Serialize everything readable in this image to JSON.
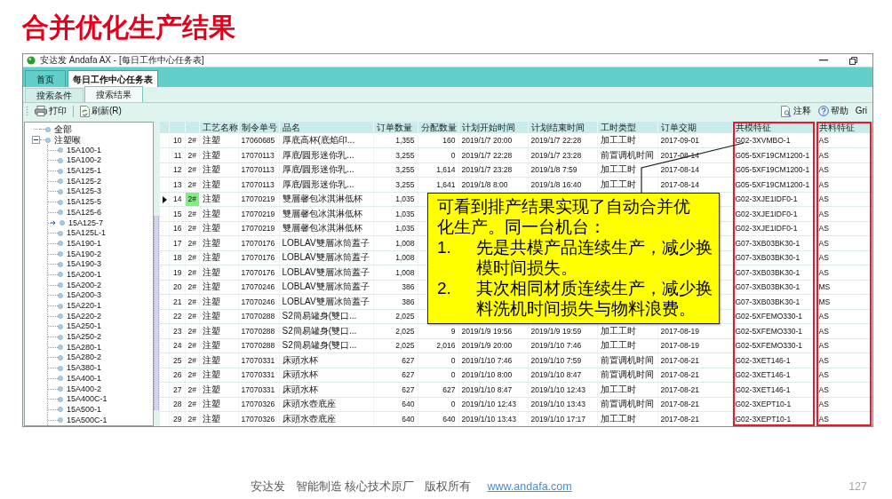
{
  "slide": {
    "title": "合并优化生产结果"
  },
  "window": {
    "title": "安达发 Andafa AX - [每日工作中心任务表]"
  },
  "tabs": [
    {
      "label": "首页",
      "selected": false
    },
    {
      "label": "每日工作中心任务表",
      "selected": true
    }
  ],
  "subtabs": [
    {
      "label": "搜索条件",
      "selected": false
    },
    {
      "label": "搜索结果",
      "selected": true
    }
  ],
  "toolbar": {
    "left": [
      {
        "label": "打印"
      },
      {
        "label": "刷新(R)"
      }
    ],
    "right": [
      {
        "label": "注释"
      },
      {
        "label": "帮助"
      },
      {
        "label": "Gri"
      }
    ]
  },
  "tree": [
    {
      "label": "全部",
      "selected": false
    },
    {
      "label": "注塑喉",
      "selected": false,
      "expanded": true,
      "children": [
        {
          "label": "15A100-1",
          "selected": false
        },
        {
          "label": "15A100-2",
          "selected": false
        },
        {
          "label": "15A125-1",
          "selected": false
        },
        {
          "label": "15A125-2",
          "selected": false
        },
        {
          "label": "15A125-3",
          "selected": false
        },
        {
          "label": "15A125-5",
          "selected": false
        },
        {
          "label": "15A125-6",
          "selected": false
        },
        {
          "label": "15A125-7",
          "selected": true
        },
        {
          "label": "15A125L-1",
          "selected": false
        },
        {
          "label": "15A190-1",
          "selected": false
        },
        {
          "label": "15A190-2",
          "selected": false
        },
        {
          "label": "15A190-3",
          "selected": false
        },
        {
          "label": "15A200-1",
          "selected": false
        },
        {
          "label": "15A200-2",
          "selected": false
        },
        {
          "label": "15A200-3",
          "selected": false
        },
        {
          "label": "15A220-1",
          "selected": false
        },
        {
          "label": "15A220-2",
          "selected": false
        },
        {
          "label": "15A250-1",
          "selected": false
        },
        {
          "label": "15A250-2",
          "selected": false
        },
        {
          "label": "15A280-1",
          "selected": false
        },
        {
          "label": "15A280-2",
          "selected": false
        },
        {
          "label": "15A380-1",
          "selected": false
        },
        {
          "label": "15A400-1",
          "selected": false
        },
        {
          "label": "15A400-2",
          "selected": false
        },
        {
          "label": "15A400C-1",
          "selected": false
        },
        {
          "label": "15A500-1",
          "selected": false
        },
        {
          "label": "15A500C-1",
          "selected": false
        }
      ]
    }
  ],
  "table": {
    "columns": [
      {
        "label": "工艺名称",
        "highlighted": false
      },
      {
        "label": "制令单号",
        "highlighted": false
      },
      {
        "label": "品名",
        "highlighted": false
      },
      {
        "label": "订单数量",
        "highlighted": false
      },
      {
        "label": "分配数量",
        "highlighted": false
      },
      {
        "label": "计划开始时间",
        "highlighted": false
      },
      {
        "label": "计划结束时间",
        "highlighted": false
      },
      {
        "label": "工时类型",
        "highlighted": false
      },
      {
        "label": "订单交期",
        "highlighted": false
      },
      {
        "label": "共模特征",
        "highlighted": true
      },
      {
        "label": "共料特征",
        "highlighted": true
      }
    ],
    "rows": [
      {
        "column_1": "10",
        "column_2": "2#",
        "selected": false,
        "cells": [
          "注塑",
          "17060685",
          "厚底高杯(底焰印...",
          "1,355",
          "160",
          "2019/1/7 20:00",
          "2019/1/7 22:28",
          "加工工时",
          "2017-09-01",
          "G02-3XVMBO-1",
          "AS"
        ]
      },
      {
        "column_1": "11",
        "column_2": "2#",
        "selected": false,
        "cells": [
          "注塑",
          "17070113",
          "厚底/圓形迷你乳...",
          "3,255",
          "0",
          "2019/1/7 22:28",
          "2019/1/7 23:28",
          "前置调机时间",
          "2017-08-14",
          "G05-5XF19CM1200-1",
          "AS"
        ]
      },
      {
        "column_1": "12",
        "column_2": "2#",
        "selected": false,
        "cells": [
          "注塑",
          "17070113",
          "厚底/圓形迷你乳...",
          "3,255",
          "1,614",
          "2019/1/7 23:28",
          "2019/1/8 7:59",
          "加工工时",
          "2017-08-14",
          "G05-5XF19CM1200-1",
          "AS"
        ]
      },
      {
        "column_1": "13",
        "column_2": "2#",
        "selected": false,
        "cells": [
          "注塑",
          "17070113",
          "厚底/圓形迷你乳...",
          "3,255",
          "1,641",
          "2019/1/8 8:00",
          "2019/1/8 16:40",
          "加工工时",
          "2017-08-14",
          "G05-5XF19CM1200-1",
          "AS"
        ]
      },
      {
        "column_1": "14",
        "column_2": "2#",
        "selected": true,
        "cells": [
          "注塑",
          "17070219",
          "雙層馨包冰淇淋低杯",
          "1,035",
          null,
          null,
          null,
          null,
          null,
          "G02-3XJE1IDF0-1",
          "AS"
        ]
      },
      {
        "column_1": "15",
        "column_2": "2#",
        "selected": false,
        "cells": [
          "注塑",
          "17070219",
          "雙層馨包冰淇淋低杯",
          "1,035",
          null,
          null,
          null,
          null,
          null,
          "G02-3XJE1IDF0-1",
          "AS"
        ]
      },
      {
        "column_1": "16",
        "column_2": "2#",
        "selected": false,
        "cells": [
          "注塑",
          "17070219",
          "雙層馨包冰淇淋低杯",
          "1,035",
          null,
          null,
          null,
          null,
          null,
          "G02-3XJE1IDF0-1",
          "AS"
        ]
      },
      {
        "column_1": "17",
        "column_2": "2#",
        "selected": false,
        "cells": [
          "注塑",
          "17070176",
          "LOBLAV雙層冰筒蓋子",
          "1,008",
          null,
          null,
          null,
          null,
          null,
          "G07-3XB03BK30-1",
          "AS"
        ]
      },
      {
        "column_1": "18",
        "column_2": "2#",
        "selected": false,
        "cells": [
          "注塑",
          "17070176",
          "LOBLAV雙層冰筒蓋子",
          "1,008",
          null,
          null,
          null,
          null,
          null,
          "G07-3XB03BK30-1",
          "AS"
        ]
      },
      {
        "column_1": "19",
        "column_2": "2#",
        "selected": false,
        "cells": [
          "注塑",
          "17070176",
          "LOBLAV雙層冰筒蓋子",
          "1,008",
          null,
          null,
          null,
          null,
          null,
          "G07-3XB03BK30-1",
          "AS"
        ]
      },
      {
        "column_1": "20",
        "column_2": "2#",
        "selected": false,
        "cells": [
          "注塑",
          "17070246",
          "LOBLAV雙層冰筒蓋子",
          "386",
          null,
          null,
          null,
          null,
          null,
          "G07-3XB03BK30-1",
          "MS"
        ]
      },
      {
        "column_1": "21",
        "column_2": "2#",
        "selected": false,
        "cells": [
          "注塑",
          "17070246",
          "LOBLAV雙層冰筒蓋子",
          "386",
          null,
          null,
          null,
          null,
          null,
          "G07-3XB03BK30-1",
          "MS"
        ]
      },
      {
        "column_1": "22",
        "column_2": "2#",
        "selected": false,
        "cells": [
          "注塑",
          "17070288",
          "S2簡易罐身(雙口...",
          "2,025",
          null,
          null,
          null,
          null,
          null,
          "G02-5XFEMO330-1",
          "AS"
        ]
      },
      {
        "column_1": "23",
        "column_2": "2#",
        "selected": false,
        "cells": [
          "注塑",
          "17070288",
          "S2簡易罐身(雙口...",
          "2,025",
          "9",
          "2019/1/9 19:56",
          "2019/1/9 19:59",
          "加工工时",
          "2017-08-19",
          "G02-5XFEMO330-1",
          "AS"
        ]
      },
      {
        "column_1": "24",
        "column_2": "2#",
        "selected": false,
        "cells": [
          "注塑",
          "17070288",
          "S2簡易罐身(雙口...",
          "2,025",
          "2,016",
          "2019/1/9 20:00",
          "2019/1/10 7:46",
          "加工工时",
          "2017-08-19",
          "G02-5XFEMO330-1",
          "AS"
        ]
      },
      {
        "column_1": "25",
        "column_2": "2#",
        "selected": false,
        "cells": [
          "注塑",
          "17070331",
          "床頭水杯",
          "627",
          "0",
          "2019/1/10 7:46",
          "2019/1/10 7:59",
          "前置调机时间",
          "2017-08-21",
          "G02-3XET146-1",
          "AS"
        ]
      },
      {
        "column_1": "26",
        "column_2": "2#",
        "selected": false,
        "cells": [
          "注塑",
          "17070331",
          "床頭水杯",
          "627",
          "0",
          "2019/1/10 8:00",
          "2019/1/10 8:47",
          "前置调机时间",
          "2017-08-21",
          "G02-3XET146-1",
          "AS"
        ]
      },
      {
        "column_1": "27",
        "column_2": "2#",
        "selected": false,
        "cells": [
          "注塑",
          "17070331",
          "床頭水杯",
          "627",
          "627",
          "2019/1/10 8:47",
          "2019/1/10 12:43",
          "加工工时",
          "2017-08-21",
          "G02-3XET146-1",
          "AS"
        ]
      },
      {
        "column_1": "28",
        "column_2": "2#",
        "selected": false,
        "cells": [
          "注塑",
          "17070326",
          "床頭水壺底座",
          "640",
          "0",
          "2019/1/10 12:43",
          "2019/1/10 13:43",
          "前置调机时间",
          "2017-08-21",
          "G02-3XEPT10-1",
          "AS"
        ]
      },
      {
        "column_1": "29",
        "column_2": "2#",
        "selected": false,
        "cells": [
          "注塑",
          "17070326",
          "床頭水壺底座",
          "640",
          "640",
          "2019/1/10 13:43",
          "2019/1/10 17:17",
          "加工工时",
          "2017-08-21",
          "G02-3XEPT10-1",
          "AS"
        ]
      }
    ]
  },
  "callout": {
    "text": "可看到排产结果实现了自动合并优化生产。同一台机台：",
    "items": [
      {
        "number": "1.",
        "text": "先是共模产品连续生产，减少换模时间损失。"
      },
      {
        "number": "2.",
        "text": "其次相同材质连续生产，减少换料洗机时间损失与物料浪费。"
      }
    ]
  },
  "footer": {
    "items": [
      "安达发",
      "智能制造 核心技术原厂",
      "版权所有"
    ],
    "link": "www.andafa.com",
    "page_number": "127"
  }
}
